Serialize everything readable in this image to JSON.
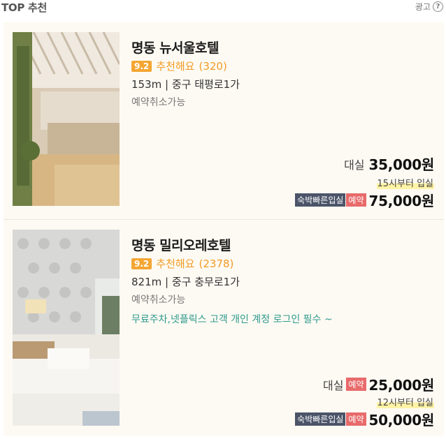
{
  "section": {
    "title": "TOP 추천",
    "ad_label": "광고",
    "help_icon": "help-circle-icon"
  },
  "hotels": [
    {
      "name": "명동 뉴서울호텔",
      "score": "9.2",
      "rating_text": "추천해요",
      "review_count": "(320)",
      "location": "153m | 중구 태평로1가",
      "cancel": "예약취소가능",
      "day_label": "대실",
      "day_price": "35,000원",
      "checkin": "15시부터 입실",
      "stay_tag": "숙박빠른입실",
      "reserve_tag": "예약",
      "stay_price": "75,000원"
    },
    {
      "name": "명동 밀리오레호텔",
      "score": "9.2",
      "rating_text": "추천해요",
      "review_count": "(2378)",
      "location": "821m | 중구 충무로1가",
      "cancel": "예약취소가능",
      "promo": "무료주차,넷플릭스 고객 개인 계정 로그인 필수 ~",
      "day_label": "대실",
      "day_tag": "예약",
      "day_price": "25,000원",
      "checkin": "12시부터 입실",
      "stay_tag": "숙박빠른입실",
      "reserve_tag": "예약",
      "stay_price": "50,000원"
    }
  ],
  "colors": {
    "accent": "#f29b24",
    "badge_dark": "#4b5468",
    "badge_red": "#e86a6a",
    "promo": "#2e9a8c",
    "card_bg": "#fdfaf3"
  }
}
